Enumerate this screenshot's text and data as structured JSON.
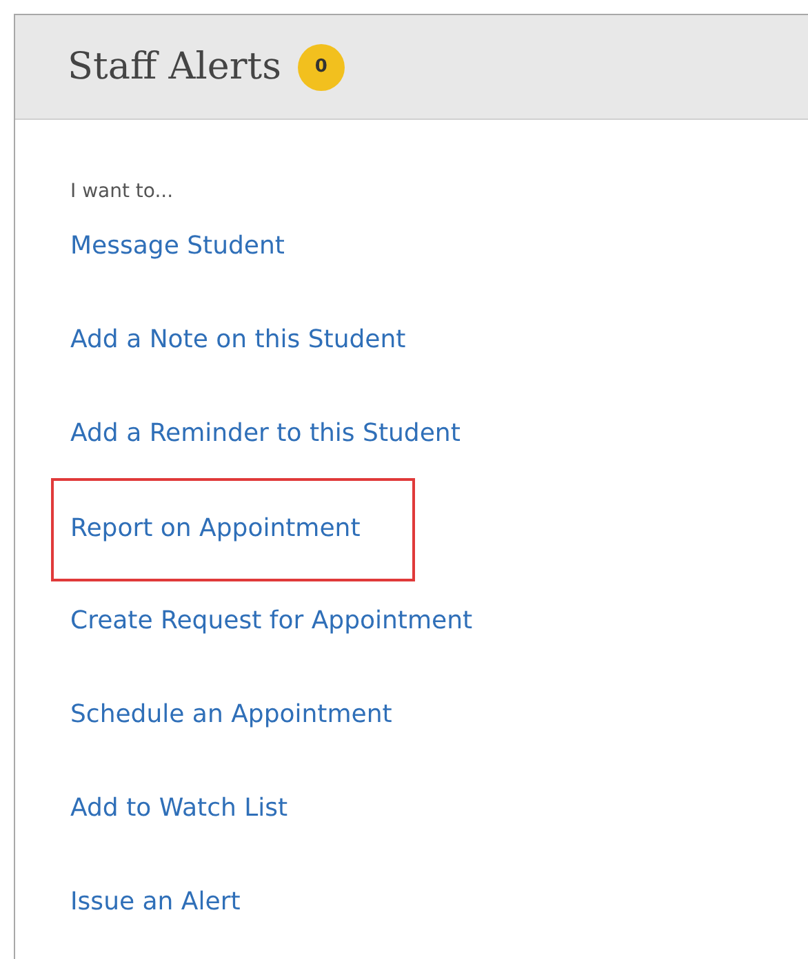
{
  "panel": {
    "title": "Staff Alerts",
    "badge": "0"
  },
  "intro": "I want to...",
  "actions": [
    {
      "label": "Message Student",
      "highlighted": false
    },
    {
      "label": "Add a Note on this Student",
      "highlighted": false
    },
    {
      "label": "Add a Reminder to this Student",
      "highlighted": false
    },
    {
      "label": "Report on Appointment",
      "highlighted": true
    },
    {
      "label": "Create Request for Appointment",
      "highlighted": false
    },
    {
      "label": "Schedule an Appointment",
      "highlighted": false
    },
    {
      "label": "Add to Watch List",
      "highlighted": false
    },
    {
      "label": "Issue an Alert",
      "highlighted": false
    }
  ]
}
